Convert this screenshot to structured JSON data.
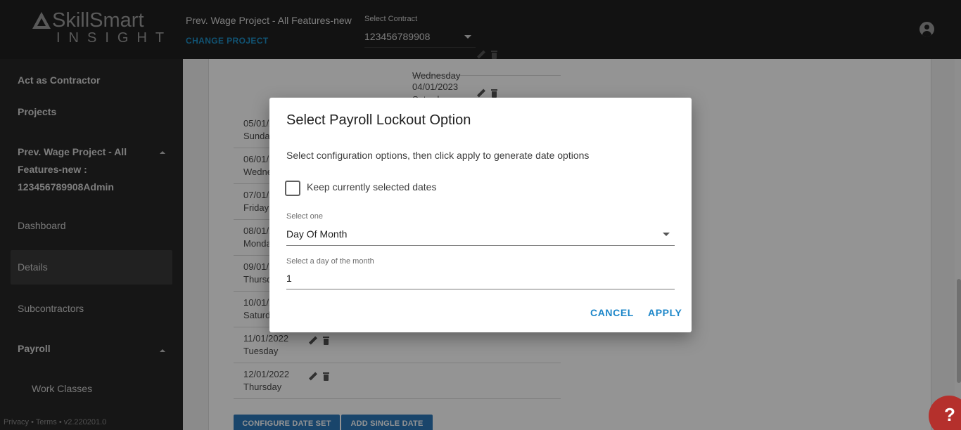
{
  "header": {
    "logo_name": "SkillSmart",
    "logo_sub": "INSIGHT",
    "project_title": "Prev. Wage Project - All Features-new",
    "change_project": "CHANGE PROJECT",
    "contract_label": "Select Contract",
    "contract_value": "123456789908"
  },
  "sidebar": {
    "act_as_contractor": "Act as Contractor",
    "projects": "Projects",
    "project_name": "Prev. Wage Project - All Features-new : 123456789908Admin",
    "dashboard": "Dashboard",
    "details": "Details",
    "subcontractors": "Subcontractors",
    "payroll": "Payroll",
    "work_classes": "Work Classes",
    "footer": "Privacy • Terms • v2.220201.0"
  },
  "background_rows": [
    {
      "line1": "",
      "line2": "Wednesday"
    },
    {
      "line1": "04/01/2023",
      "line2": "Saturday"
    },
    {
      "line1": "05/01/2022",
      "line2": "Sunday"
    },
    {
      "line1": "06/01/2022",
      "line2": "Wednesday"
    },
    {
      "line1": "07/01/2022",
      "line2": "Friday"
    },
    {
      "line1": "08/01/2022",
      "line2": "Monday"
    },
    {
      "line1": "09/01/2022",
      "line2": "Thursday"
    },
    {
      "line1": "10/01/2022",
      "line2": "Saturday"
    },
    {
      "line1": "11/01/2022",
      "line2": "Tuesday"
    },
    {
      "line1": "12/01/2022",
      "line2": "Thursday"
    }
  ],
  "buttons": {
    "configure_date_set": "CONFIGURE DATE SET",
    "add_single_date": "ADD SINGLE DATE",
    "help": "?"
  },
  "dialog": {
    "title": "Select Payroll Lockout Option",
    "description": "Select configuration options, then click apply to generate date options",
    "keep_selected_label": "Keep currently selected dates",
    "keep_selected_checked": false,
    "select_one_label": "Select one",
    "select_one_value": "Day Of Month",
    "day_label": "Select a day of the month",
    "day_value": "1",
    "cancel": "CANCEL",
    "apply": "APPLY"
  }
}
